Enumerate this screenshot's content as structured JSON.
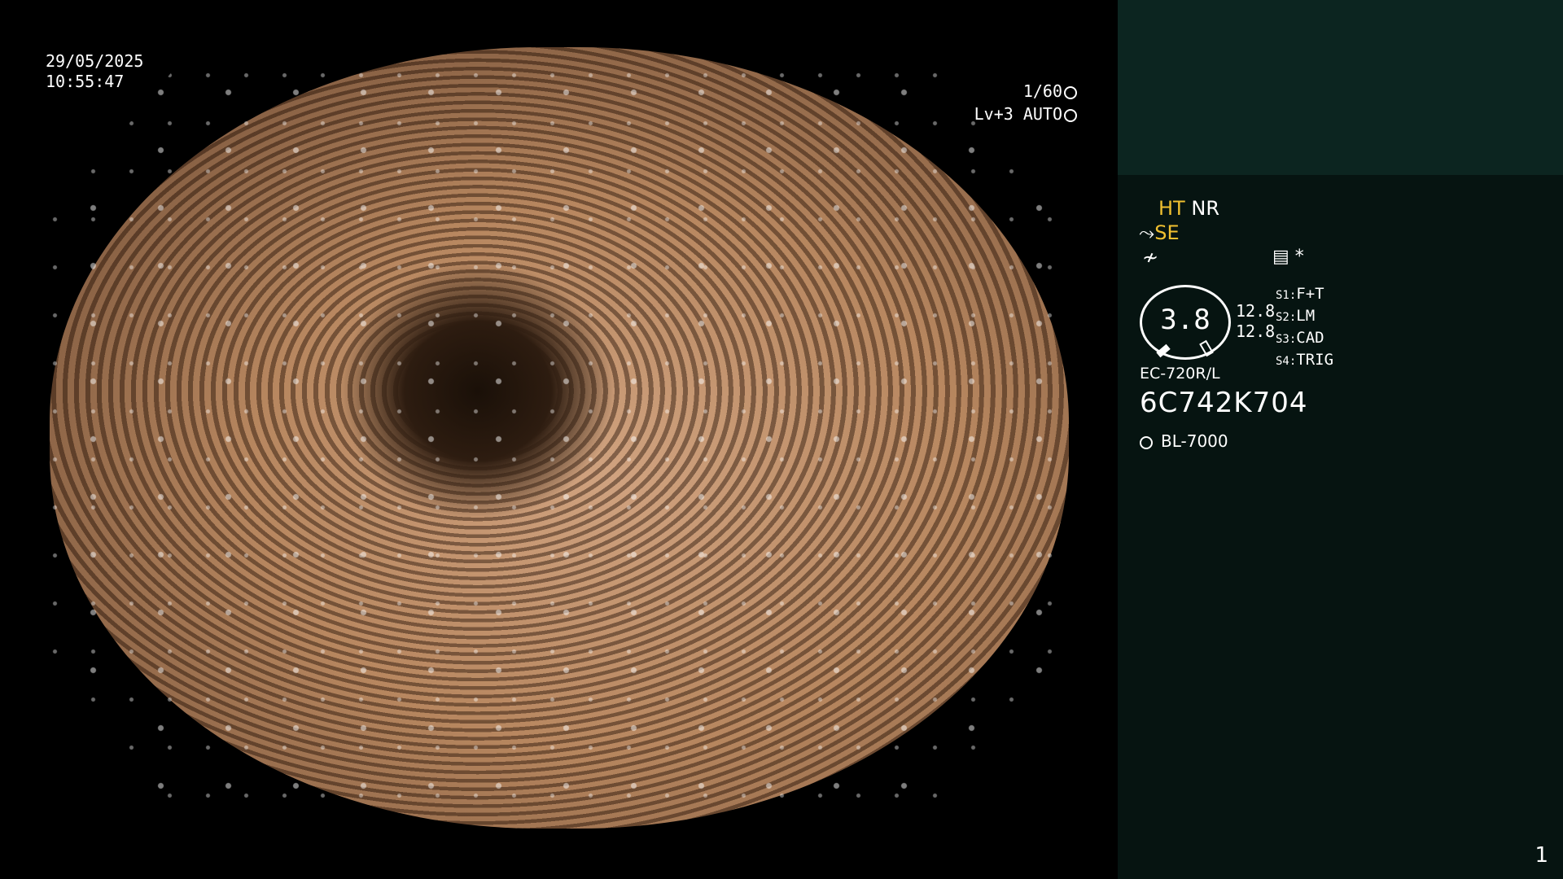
{
  "timestamp": {
    "date": "29/05/2025",
    "time": "10:55:47"
  },
  "exposure": {
    "shutter": "1/60",
    "level": "Lv+3 AUTO"
  },
  "panel": {
    "mode1": "HT",
    "mode2": "NR",
    "mode3": "SE",
    "glyph1": "≁",
    "star": "*",
    "value": "3.8",
    "num1": "12.8",
    "num2": "12.8",
    "switches": [
      {
        "key": "S1:",
        "val": "F+T"
      },
      {
        "key": "S2:",
        "val": "LM"
      },
      {
        "key": "S3:",
        "val": "CAD"
      },
      {
        "key": "S4:",
        "val": "TRIG"
      }
    ],
    "model": "EC-720R/L",
    "serial": "6C742K704",
    "light": "BL-7000"
  },
  "page_number": "1",
  "colors": {
    "accent": "#f0c030",
    "panel_bg": "#061411",
    "panel_top": "#0c2520"
  }
}
